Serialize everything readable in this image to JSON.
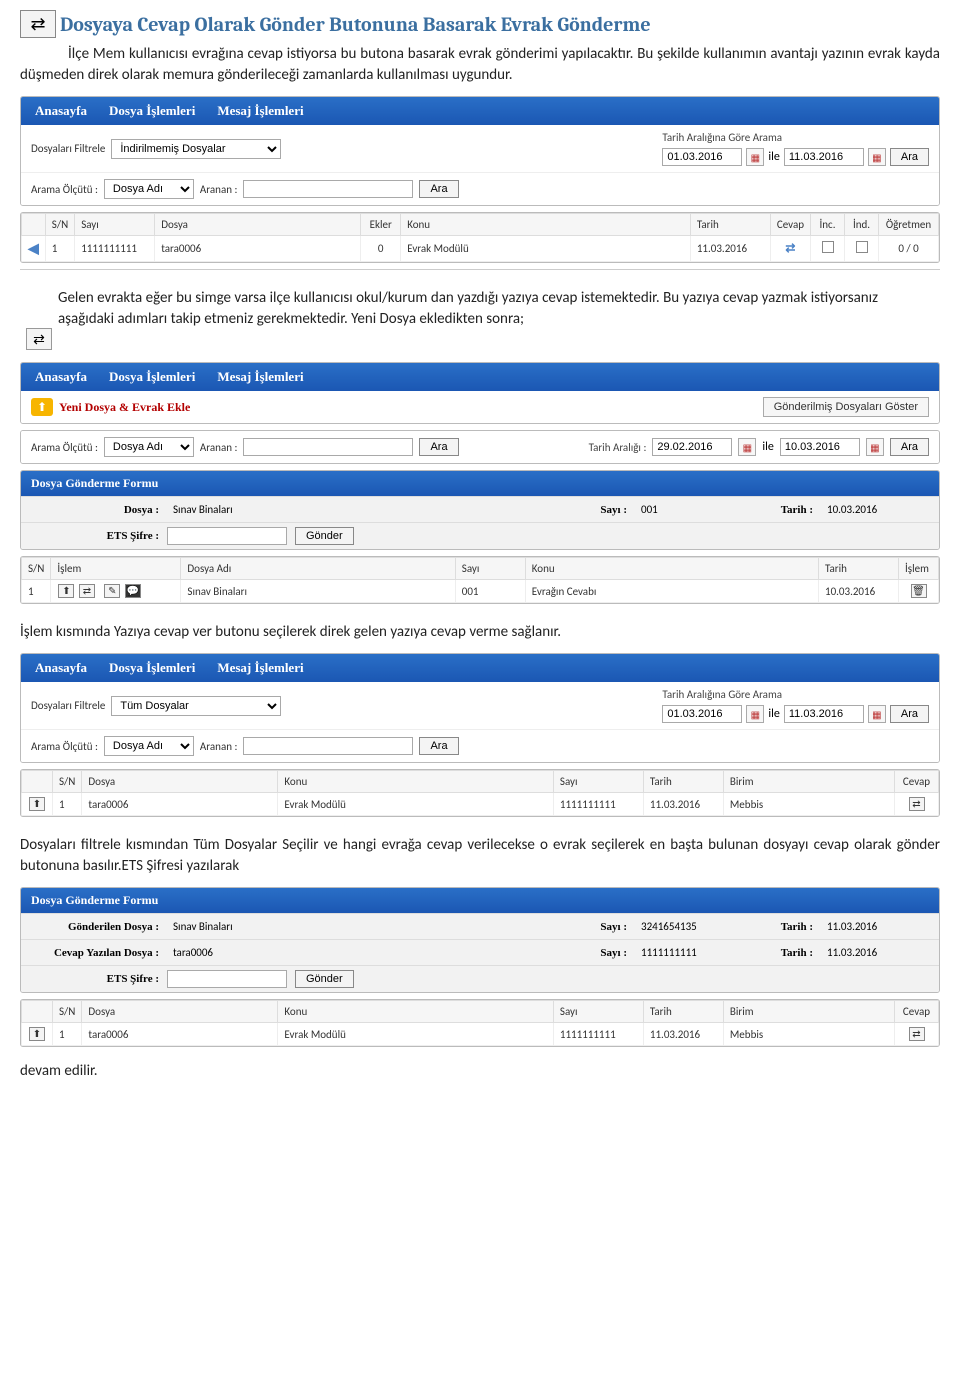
{
  "menu": {
    "home": "Anasayfa",
    "file_ops": "Dosya İşlemleri",
    "msg_ops": "Mesaj İşlemleri"
  },
  "title": "Dosyaya Cevap Olarak Gönder Butonuna Basarak Evrak Gönderme",
  "para1": "İlçe Mem kullanıcısı evrağına cevap istiyorsa bu butona basarak evrak gönderimi yapılacaktır. Bu şekilde kullanımın avantajı yazının evrak kayda düşmeden direk olarak memura gönderileceği zamanlarda kullanılması uygundur.",
  "explain": "Gelen evrakta eğer bu simge varsa ilçe kullanıcısı okul/kurum dan yazdığı yazıya cevap istemektedir. Bu yazıya cevap yazmak istiyorsanız aşağıdaki adımları takip etmeniz gerekmektedir. Yeni Dosya ekledikten sonra;",
  "para2": "İşlem kısmında Yazıya cevap ver butonu seçilerek direk gelen yazıya cevap verme sağlanır.",
  "para3": "Dosyaları filtrele kısmından Tüm Dosyalar Seçilir ve hangi evrağa cevap verilecekse o evrak seçilerek en başta bulunan dosyayı cevap olarak gönder butonuna basılır.ETS Şifresi yazılarak",
  "para4": "devam edilir.",
  "panel1": {
    "filter_label": "Dosyaları Filtrele",
    "filter_value": "İndirilmemiş Dosyalar",
    "criteria_label": "Arama Ölçütü :",
    "criteria_value": "Dosya Adı",
    "search_label": "Aranan :",
    "search_btn": "Ara",
    "date_label": "Tarih Aralığına Göre Arama",
    "date_from": "01.03.2016",
    "date_sep": "ile",
    "date_to": "11.03.2016",
    "date_btn": "Ara",
    "cols": {
      "sn": "S/N",
      "sayi": "Sayı",
      "dosya": "Dosya",
      "ekler": "Ekler",
      "konu": "Konu",
      "tarih": "Tarih",
      "cevap": "Cevap",
      "inc": "İnc.",
      "ind": "İnd.",
      "ogretmen": "Öğretmen"
    },
    "row": {
      "sn": "1",
      "sayi": "1111111111",
      "dosya": "tara0006",
      "ekler": "0",
      "konu": "Evrak Modülü",
      "tarih": "11.03.2016",
      "ogretmen": "0 / 0"
    }
  },
  "panel2": {
    "new_btn": "Yeni Dosya & Evrak Ekle",
    "sent_btn": "Gönderilmiş Dosyaları Göster",
    "criteria_label": "Arama Ölçütü :",
    "criteria_value": "Dosya Adı",
    "search_label": "Aranan :",
    "search_btn": "Ara",
    "date_label": "Tarih Aralığı :",
    "date_from": "29.02.2016",
    "date_sep": "ile",
    "date_to": "10.03.2016",
    "date_btn": "Ara",
    "form_title": "Dosya Gönderme Formu",
    "dosya_l": "Dosya :",
    "dosya_v": "Sınav Binaları",
    "sayi_l": "Sayı :",
    "sayi_v": "001",
    "tarih_l": "Tarih :",
    "tarih_v": "10.03.2016",
    "ets_l": "ETS Şifre :",
    "gonder_btn": "Gönder",
    "cols": {
      "sn": "S/N",
      "islem": "İşlem",
      "dosya": "Dosya Adı",
      "sayi": "Sayı",
      "konu": "Konu",
      "tarih": "Tarih",
      "islem2": "İşlem"
    },
    "row": {
      "sn": "1",
      "dosya": "Sınav Binaları",
      "sayi": "001",
      "konu": "Evrağın Cevabı",
      "tarih": "10.03.2016"
    }
  },
  "panel3": {
    "filter_label": "Dosyaları Filtrele",
    "filter_value": "Tüm Dosyalar",
    "criteria_label": "Arama Ölçütü :",
    "criteria_value": "Dosya Adı",
    "search_label": "Aranan :",
    "search_btn": "Ara",
    "date_label": "Tarih Aralığına Göre Arama",
    "date_from": "01.03.2016",
    "date_sep": "ile",
    "date_to": "11.03.2016",
    "date_btn": "Ara",
    "cols": {
      "sn": "S/N",
      "dosya": "Dosya",
      "konu": "Konu",
      "sayi": "Sayı",
      "tarih": "Tarih",
      "birim": "Birim",
      "cevap": "Cevap"
    },
    "row": {
      "sn": "1",
      "dosya": "tara0006",
      "konu": "Evrak Modülü",
      "sayi": "1111111111",
      "tarih": "11.03.2016",
      "birim": "Mebbis"
    }
  },
  "panel4": {
    "form_title": "Dosya Gönderme Formu",
    "sent_l": "Gönderilen Dosya :",
    "sent_v": "Sınav Binaları",
    "sayi_l": "Sayı :",
    "sayi_v": "3241654135",
    "tarih_l": "Tarih :",
    "tarih_v": "11.03.2016",
    "reply_l": "Cevap Yazılan Dosya :",
    "reply_v": "tara0006",
    "sayi2_v": "1111111111",
    "tarih2_v": "11.03.2016",
    "ets_l": "ETS Şifre :",
    "gonder_btn": "Gönder",
    "cols": {
      "sn": "S/N",
      "dosya": "Dosya",
      "konu": "Konu",
      "sayi": "Sayı",
      "tarih": "Tarih",
      "birim": "Birim",
      "cevap": "Cevap"
    },
    "row": {
      "sn": "1",
      "dosya": "tara0006",
      "konu": "Evrak Modülü",
      "sayi": "1111111111",
      "tarih": "11.03.2016",
      "birim": "Mebbis"
    }
  }
}
